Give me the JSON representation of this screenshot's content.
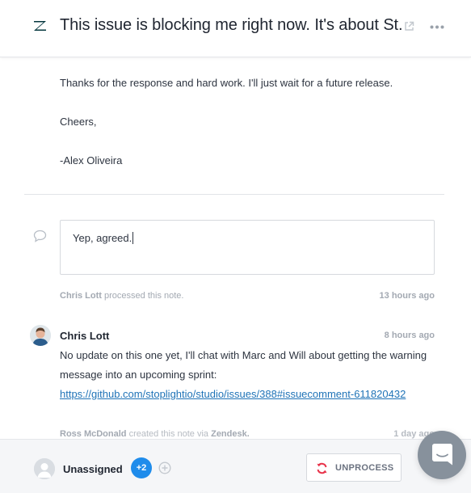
{
  "header": {
    "title": "This issue is blocking me right now. It's about St..."
  },
  "email": {
    "line1": "Thanks for the response and hard work. I'll just wait for a future release.",
    "line2": "Cheers,",
    "line3": "-Alex Oliveira"
  },
  "note": {
    "value": "Yep, agreed."
  },
  "processed": {
    "name": "Chris Lott",
    "action": "processed this note.",
    "time": "13 hours ago"
  },
  "comment": {
    "author": "Chris Lott",
    "time": "8 hours ago",
    "text": "No update on this one yet, I'll chat with Marc and Will about getting the warning message into an upcoming sprint: ",
    "link": "https://github.com/stoplightio/studio/issues/388#issuecomment-611820432"
  },
  "next_note": {
    "name": "Ross McDonald",
    "action": "created this note via",
    "via": "Zendesk.",
    "time": "1 day ago"
  },
  "footer": {
    "assignee": "Unassigned",
    "extra_count": "+2",
    "unprocess_label": "UNPROCESS"
  },
  "colors": {
    "accent": "#1f8ceb",
    "link": "#1f73b7",
    "unprocess_icon": "#e8334a",
    "launcher": "#87919c"
  },
  "icons": [
    "zendesk-logo-icon",
    "external-link-icon",
    "more-icon",
    "comment-bubble-icon",
    "plus-circle-icon",
    "unprocess-icon",
    "chat-icon"
  ]
}
